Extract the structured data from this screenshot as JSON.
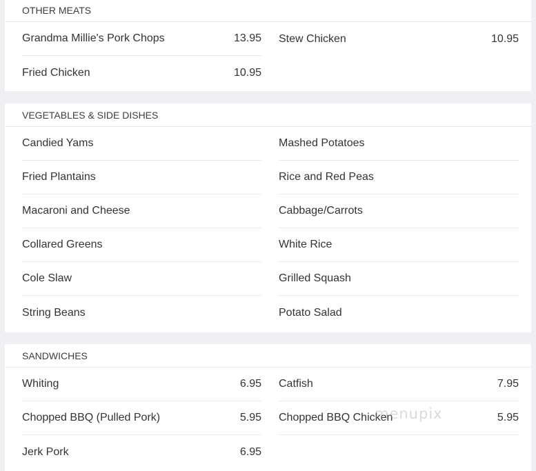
{
  "sections": {
    "other_meats": {
      "title": "OTHER MEATS",
      "items": [
        {
          "name": "Grandma Millie's Pork Chops",
          "price": "13.95"
        },
        {
          "name": "Stew Chicken",
          "price": "10.95"
        },
        {
          "name": "Fried Chicken",
          "price": "10.95"
        }
      ]
    },
    "vegetables": {
      "title": "VEGETABLES & SIDE DISHES",
      "items": [
        {
          "name": "Candied Yams"
        },
        {
          "name": "Mashed Potatoes"
        },
        {
          "name": "Fried Plantains"
        },
        {
          "name": "Rice and Red Peas"
        },
        {
          "name": "Macaroni and Cheese"
        },
        {
          "name": "Cabbage/Carrots"
        },
        {
          "name": "Collared Greens"
        },
        {
          "name": "White Rice"
        },
        {
          "name": "Cole Slaw"
        },
        {
          "name": "Grilled Squash"
        },
        {
          "name": "String Beans"
        },
        {
          "name": "Potato Salad"
        }
      ]
    },
    "sandwiches": {
      "title": "SANDWICHES",
      "items": [
        {
          "name": "Whiting",
          "price": "6.95"
        },
        {
          "name": "Catfish",
          "price": "7.95"
        },
        {
          "name": "Chopped BBQ (Pulled Pork)",
          "price": "5.95"
        },
        {
          "name": "Chopped BBQ Chicken",
          "price": "5.95"
        },
        {
          "name": "Jerk Pork",
          "price": "6.95"
        }
      ]
    }
  },
  "watermark": "menupix"
}
